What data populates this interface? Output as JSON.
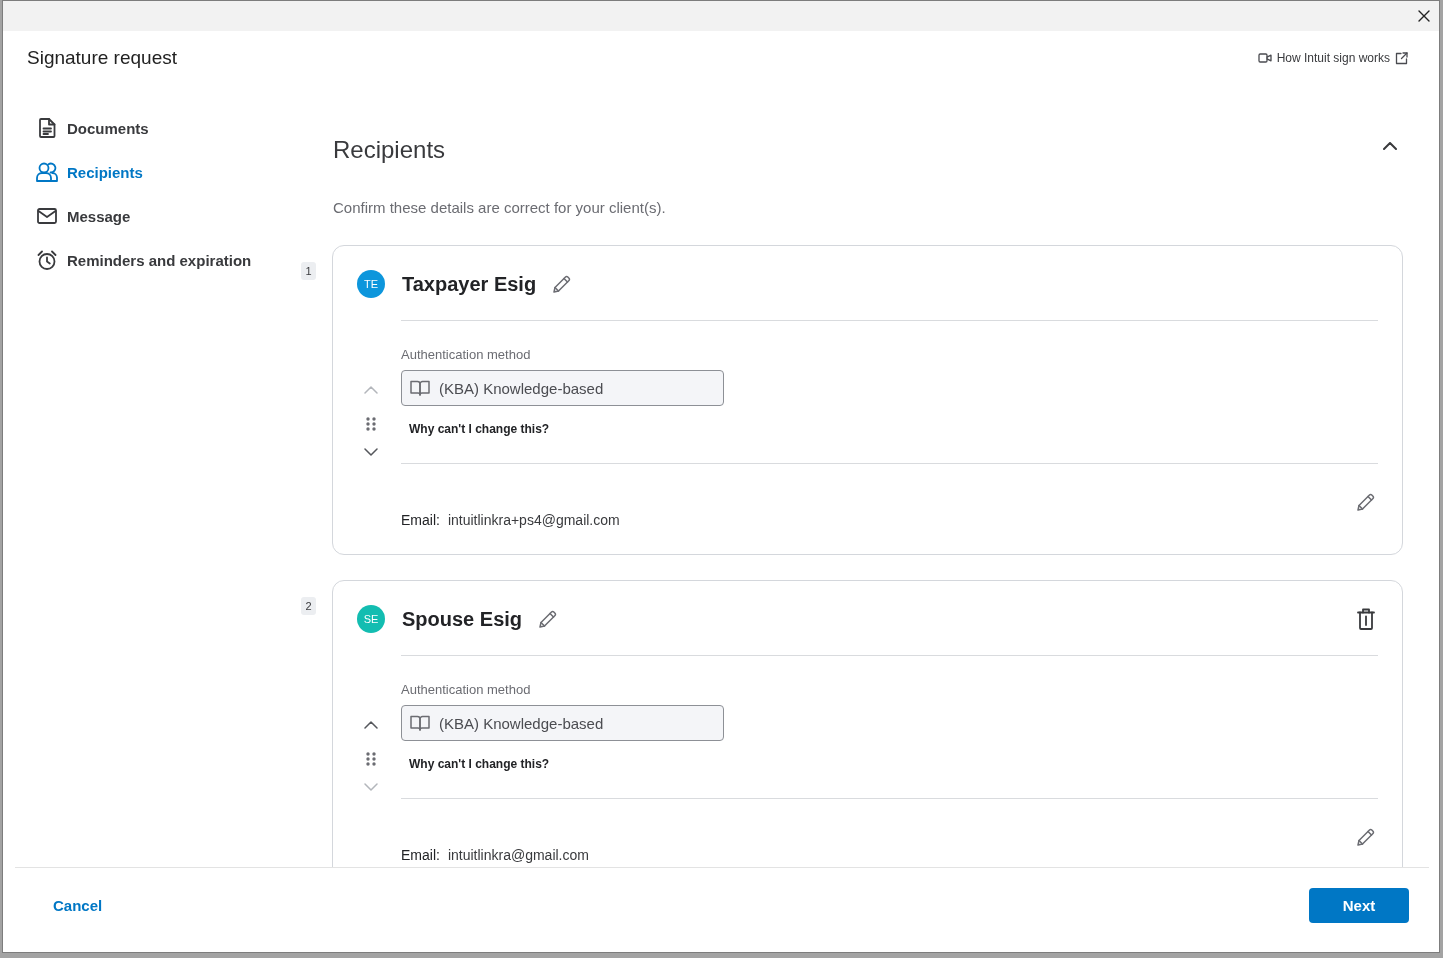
{
  "header": {
    "title": "Signature request",
    "help_link": "How Intuit sign works"
  },
  "sidebar": {
    "items": [
      {
        "label": "Documents",
        "selected": false
      },
      {
        "label": "Recipients",
        "selected": true
      },
      {
        "label": "Message",
        "selected": false
      },
      {
        "label": "Reminders and expiration",
        "selected": false
      }
    ]
  },
  "recipients_section": {
    "title": "Recipients",
    "expanded": true,
    "subtitle": "Confirm these details are correct for your client(s).",
    "recipients": [
      {
        "order": "1",
        "initials": "TE",
        "color": "#0d96dc",
        "name": "Taxpayer Esig",
        "deletable": false,
        "can_move_up": false,
        "can_move_down": true,
        "auth_label": "Authentication method",
        "auth_value": "(KBA) Knowledge-based",
        "auth_disabled": true,
        "help_link": "Why can't I change this?",
        "email_label": "Email:",
        "email": "intuitlinkra+ps4@gmail.com"
      },
      {
        "order": "2",
        "initials": "SE",
        "color": "#13bdb1",
        "name": "Spouse Esig",
        "deletable": true,
        "can_move_up": true,
        "can_move_down": false,
        "auth_label": "Authentication method",
        "auth_value": "(KBA) Knowledge-based",
        "auth_disabled": true,
        "help_link": "Why can't I change this?",
        "email_label": "Email:",
        "email": "intuitlinkra@gmail.com"
      }
    ]
  },
  "footer": {
    "cancel": "Cancel",
    "next": "Next"
  }
}
